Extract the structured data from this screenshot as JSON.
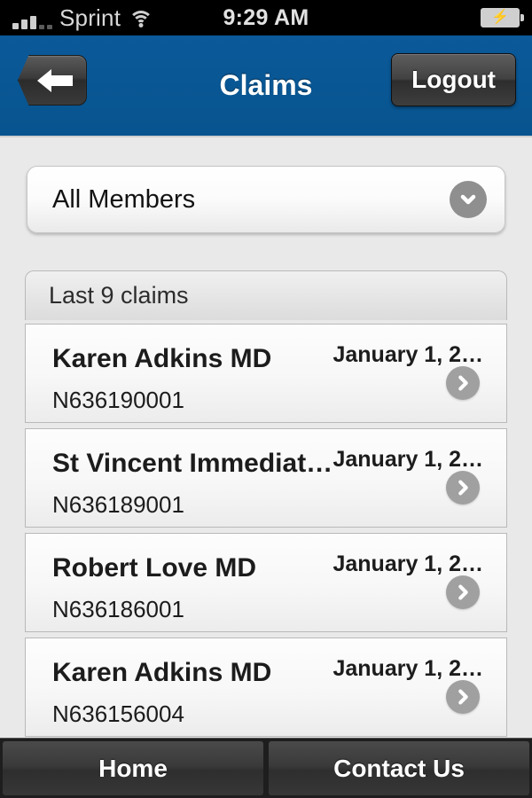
{
  "status_bar": {
    "carrier": "Sprint",
    "time": "9:29 AM",
    "signal_icon": "signal-bars-icon",
    "wifi_icon": "wifi-icon",
    "battery_icon": "battery-charging-icon",
    "battery_bolt": "⚡"
  },
  "nav": {
    "title": "Claims",
    "back_icon": "back-arrow-icon",
    "logout_label": "Logout"
  },
  "member_filter": {
    "selected": "All Members",
    "chevron_icon": "chevron-down-icon"
  },
  "claims_panel": {
    "header": "Last 9 claims",
    "rows": [
      {
        "provider": "Karen Adkins MD",
        "claim_number": "N636190001",
        "date": "January 1, 2…",
        "arrow_icon": "chevron-right-icon"
      },
      {
        "provider": "St Vincent Immediat…",
        "claim_number": "N636189001",
        "date": "January 1, 2…",
        "arrow_icon": "chevron-right-icon"
      },
      {
        "provider": "Robert Love MD",
        "claim_number": "N636186001",
        "date": "January 1, 2…",
        "arrow_icon": "chevron-right-icon"
      },
      {
        "provider": "Karen Adkins MD",
        "claim_number": "N636156004",
        "date": "January 1, 2…",
        "arrow_icon": "chevron-right-icon"
      }
    ]
  },
  "tab_bar": {
    "tabs": [
      {
        "label": "Home"
      },
      {
        "label": "Contact Us"
      }
    ]
  },
  "colors": {
    "nav_blue": "#0b5999",
    "page_background": "#e9e9e9",
    "accent_gray": "#8f8f8f",
    "tab_dark": "#3a3a3a"
  }
}
